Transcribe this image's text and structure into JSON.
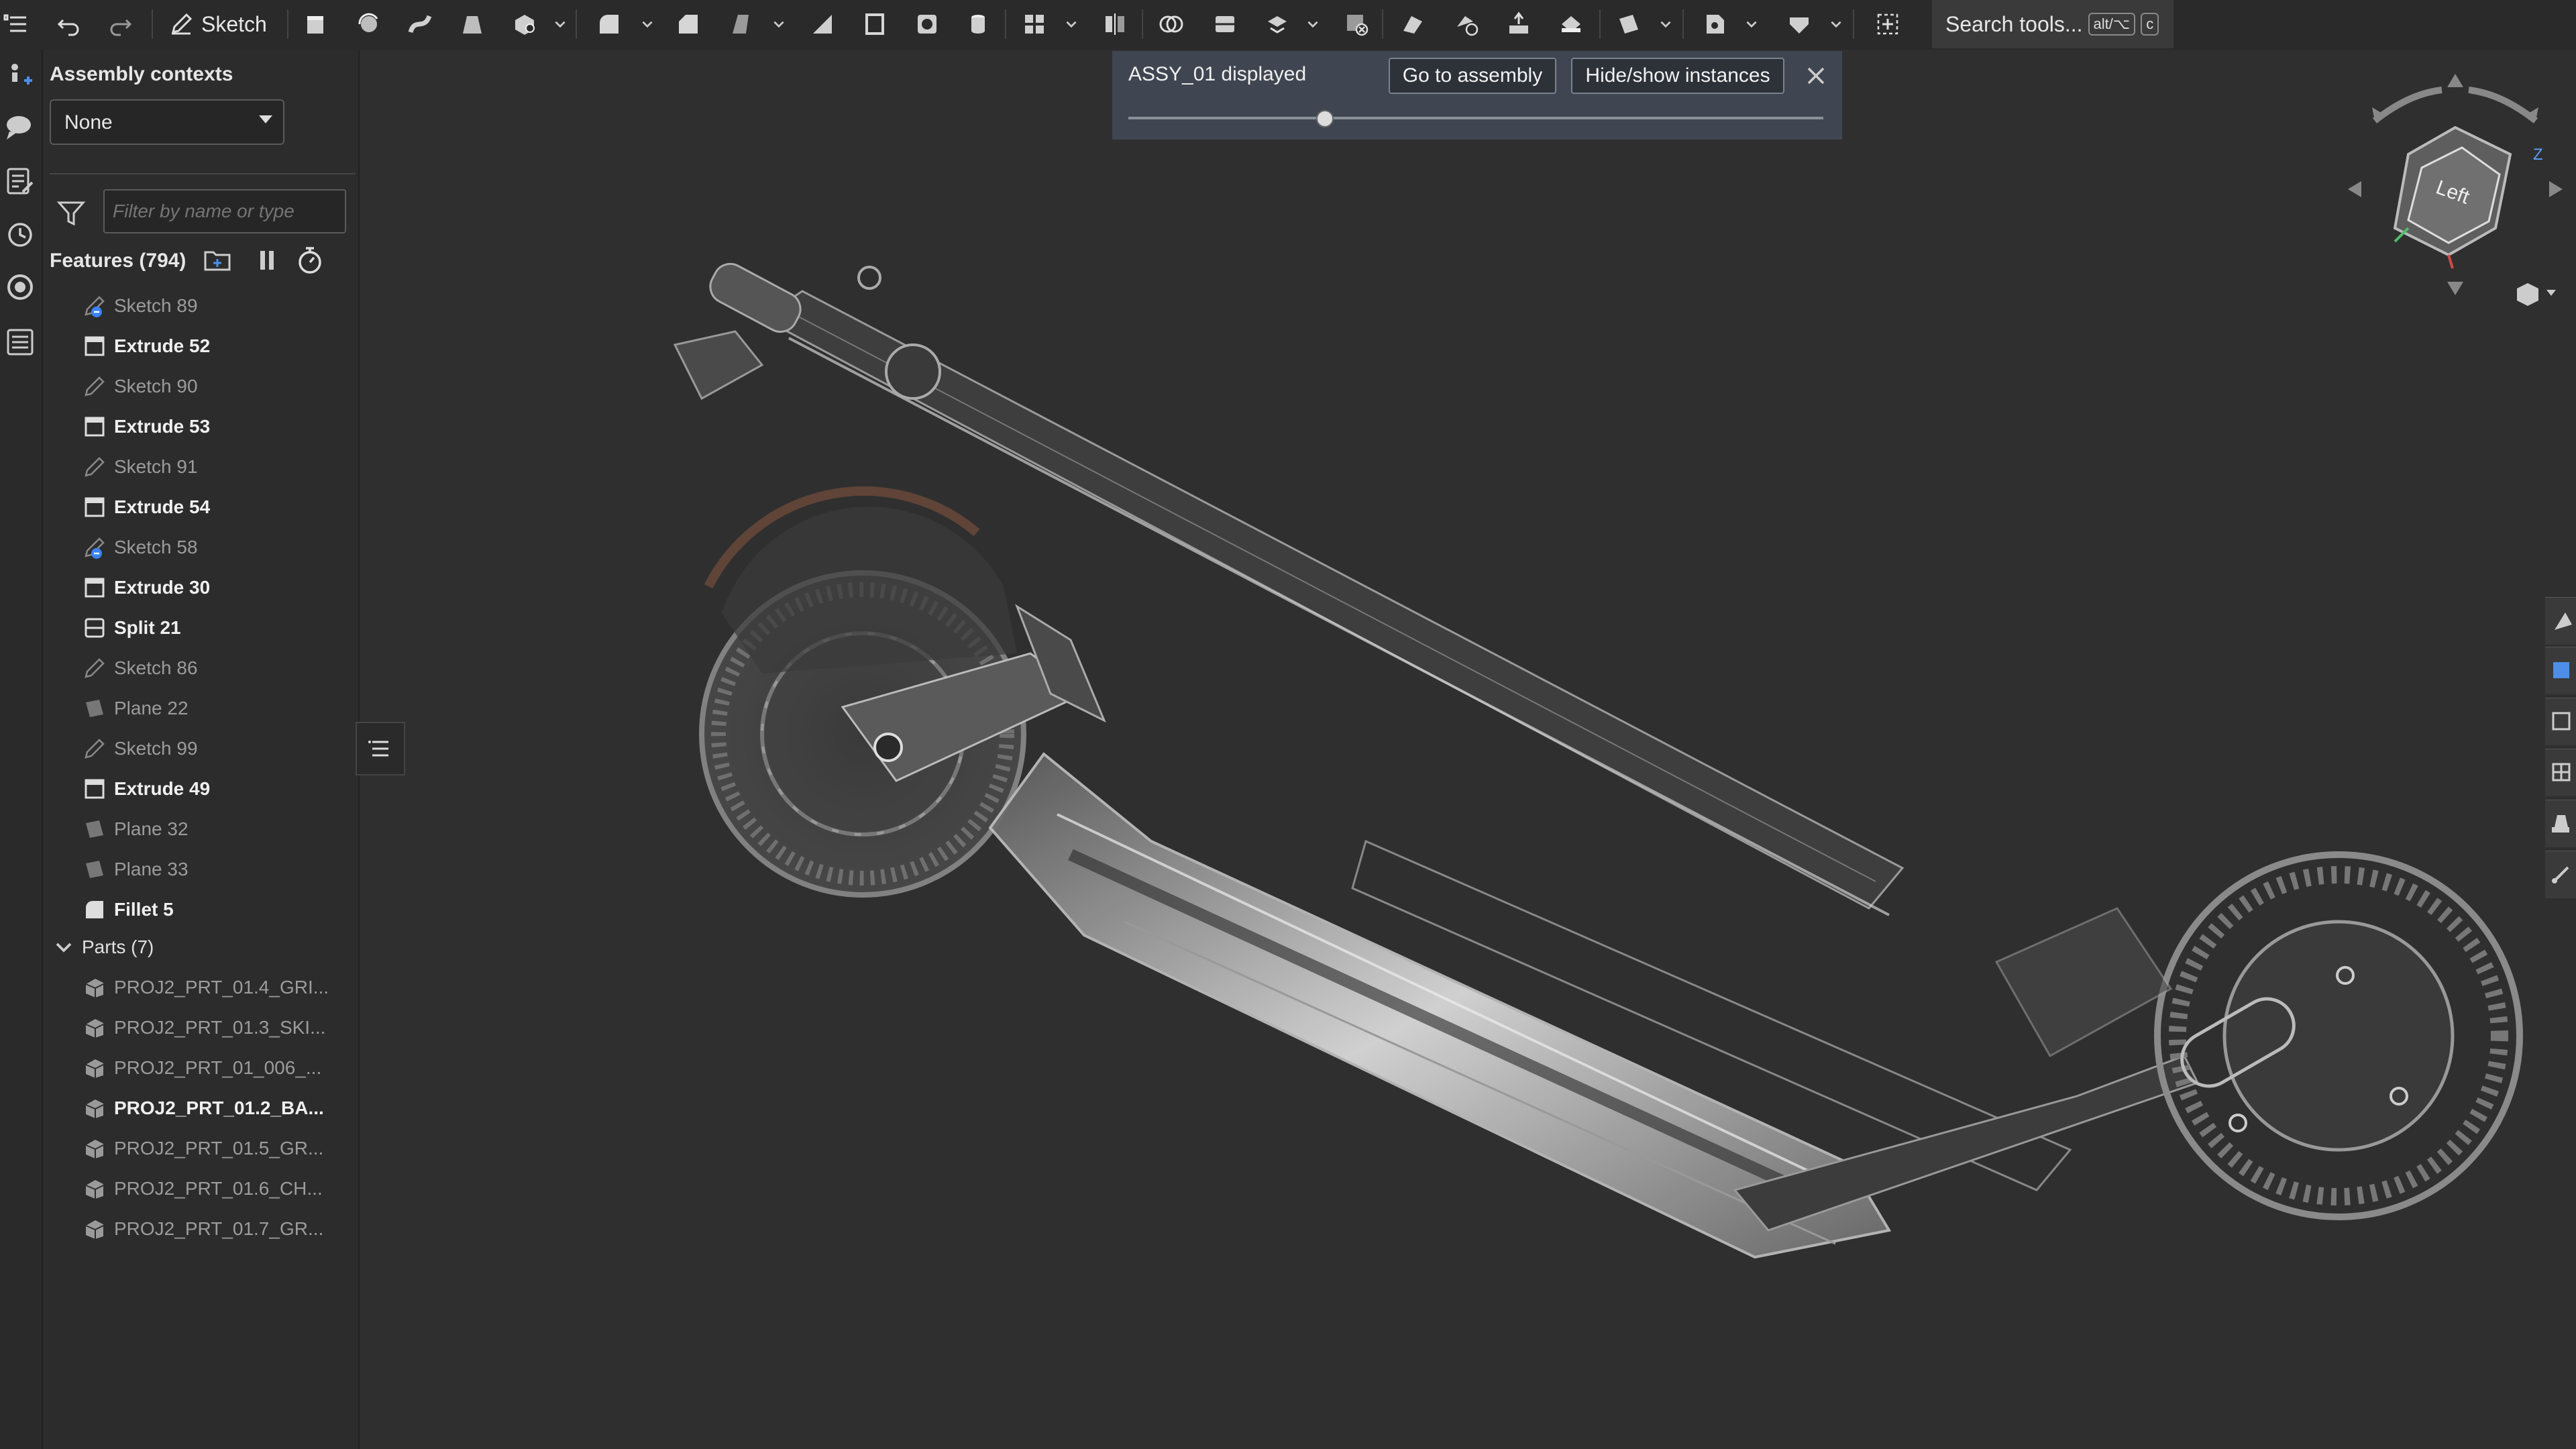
{
  "toolbar": {
    "sketch_label": "Sketch",
    "search_label": "Search tools...",
    "shortcut_mod": "alt/⌥",
    "shortcut_key": "c"
  },
  "panel": {
    "contexts_label": "Assembly contexts",
    "contexts_value": "None",
    "filter_placeholder": "Filter by name or type",
    "features_label": "Features (794)",
    "features": [
      {
        "label": "Sketch 89",
        "kind": "sketch-linked",
        "active": false
      },
      {
        "label": "Extrude 52",
        "kind": "extrude",
        "active": true
      },
      {
        "label": "Sketch 90",
        "kind": "sketch",
        "active": false
      },
      {
        "label": "Extrude 53",
        "kind": "extrude",
        "active": true
      },
      {
        "label": "Sketch 91",
        "kind": "sketch",
        "active": false
      },
      {
        "label": "Extrude 54",
        "kind": "extrude",
        "active": true
      },
      {
        "label": "Sketch 58",
        "kind": "sketch-linked",
        "active": false
      },
      {
        "label": "Extrude 30",
        "kind": "extrude",
        "active": true
      },
      {
        "label": "Split 21",
        "kind": "split",
        "active": true
      },
      {
        "label": "Sketch 86",
        "kind": "sketch",
        "active": false
      },
      {
        "label": "Plane 22",
        "kind": "plane",
        "active": false
      },
      {
        "label": "Sketch 99",
        "kind": "sketch",
        "active": false
      },
      {
        "label": "Extrude 49",
        "kind": "extrude",
        "active": true
      },
      {
        "label": "Plane 32",
        "kind": "plane",
        "active": false
      },
      {
        "label": "Plane 33",
        "kind": "plane",
        "active": false
      },
      {
        "label": "Fillet 5",
        "kind": "fillet",
        "active": true
      }
    ],
    "parts_label": "Parts (7)",
    "parts": [
      {
        "label": "PROJ2_PRT_01.4_GRI...",
        "active": false
      },
      {
        "label": "PROJ2_PRT_01.3_SKI...",
        "active": false
      },
      {
        "label": "PROJ2_PRT_01_006_...",
        "active": false
      },
      {
        "label": "PROJ2_PRT_01.2_BA...",
        "active": true
      },
      {
        "label": "PROJ2_PRT_01.5_GR...",
        "active": false
      },
      {
        "label": "PROJ2_PRT_01.6_CH...",
        "active": false
      },
      {
        "label": "PROJ2_PRT_01.7_GR...",
        "active": false
      }
    ]
  },
  "notice": {
    "title": "ASSY_01 displayed",
    "go_label": "Go to assembly",
    "hide_label": "Hide/show instances",
    "transparency_fraction": 0.3
  },
  "viewcube": {
    "face_label": "Left",
    "axis_z": "Z"
  },
  "colors": {
    "background": "#2f2f2f",
    "panel": "#2c2c2c",
    "notice": "#3f4651",
    "model_highlight": "#cfcfcf",
    "sketch_badge": "#3b82f6"
  }
}
